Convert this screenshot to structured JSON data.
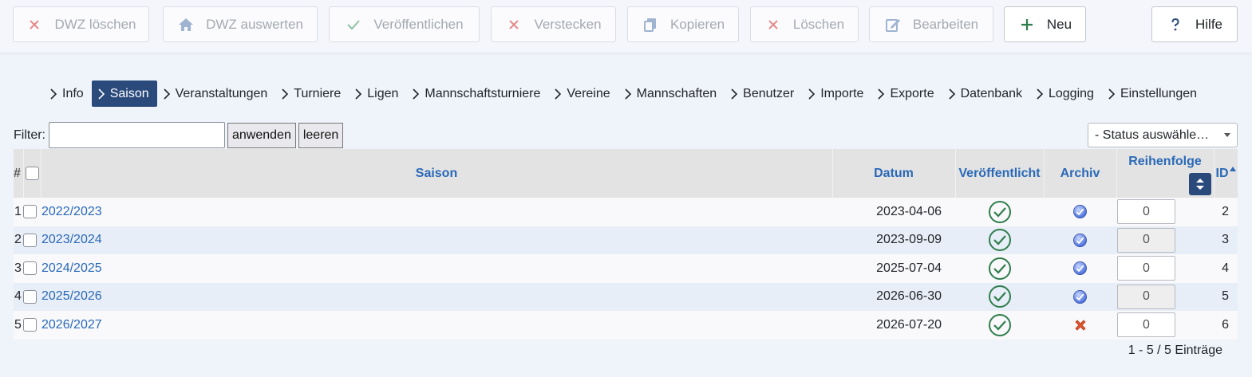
{
  "toolbar": {
    "buttons": [
      {
        "label": "DWZ löschen",
        "icon": "x-icon"
      },
      {
        "label": "DWZ auswerten",
        "icon": "home-icon"
      },
      {
        "label": "Veröffentlichen",
        "icon": "check-icon"
      },
      {
        "label": "Verstecken",
        "icon": "x-icon"
      },
      {
        "label": "Kopieren",
        "icon": "copy-icon"
      },
      {
        "label": "Löschen",
        "icon": "x-icon"
      },
      {
        "label": "Bearbeiten",
        "icon": "edit-icon"
      },
      {
        "label": "Neu",
        "icon": "plus-icon"
      },
      {
        "label": "Hilfe",
        "icon": "question-icon"
      }
    ]
  },
  "nav": {
    "items": [
      "Info",
      "Saison",
      "Veranstaltungen",
      "Turniere",
      "Ligen",
      "Mannschaftsturniere",
      "Vereine",
      "Mannschaften",
      "Benutzer",
      "Importe",
      "Exporte",
      "Datenbank",
      "Logging",
      "Einstellungen"
    ],
    "active": "Saison"
  },
  "filter": {
    "label": "Filter:",
    "value": "",
    "apply_label": "anwenden",
    "clear_label": "leeren",
    "status_select": "- Status auswähle…"
  },
  "table": {
    "headers": {
      "num": "#",
      "saison": "Saison",
      "datum": "Datum",
      "published": "Veröffentlicht",
      "archive": "Archiv",
      "order": "Reihenfolge",
      "id": "ID"
    },
    "rows": [
      {
        "num": "1",
        "saison": "2022/2023",
        "datum": "2023-04-06",
        "published": true,
        "archived": true,
        "order": "0",
        "id": "2"
      },
      {
        "num": "2",
        "saison": "2023/2024",
        "datum": "2023-09-09",
        "published": true,
        "archived": true,
        "order": "0",
        "id": "3"
      },
      {
        "num": "3",
        "saison": "2024/2025",
        "datum": "2025-07-04",
        "published": true,
        "archived": true,
        "order": "0",
        "id": "4"
      },
      {
        "num": "4",
        "saison": "2025/2026",
        "datum": "2026-06-30",
        "published": true,
        "archived": true,
        "order": "0",
        "id": "5"
      },
      {
        "num": "5",
        "saison": "2026/2027",
        "datum": "2026-07-20",
        "published": true,
        "archived": false,
        "order": "0",
        "id": "6"
      }
    ]
  },
  "pager": {
    "info": "1 - 5 / 5 Einträge"
  },
  "colors": {
    "accent": "#2a4a7c",
    "link": "#2a69b8",
    "success": "#2f7d4c",
    "danger": "#d9534f"
  }
}
